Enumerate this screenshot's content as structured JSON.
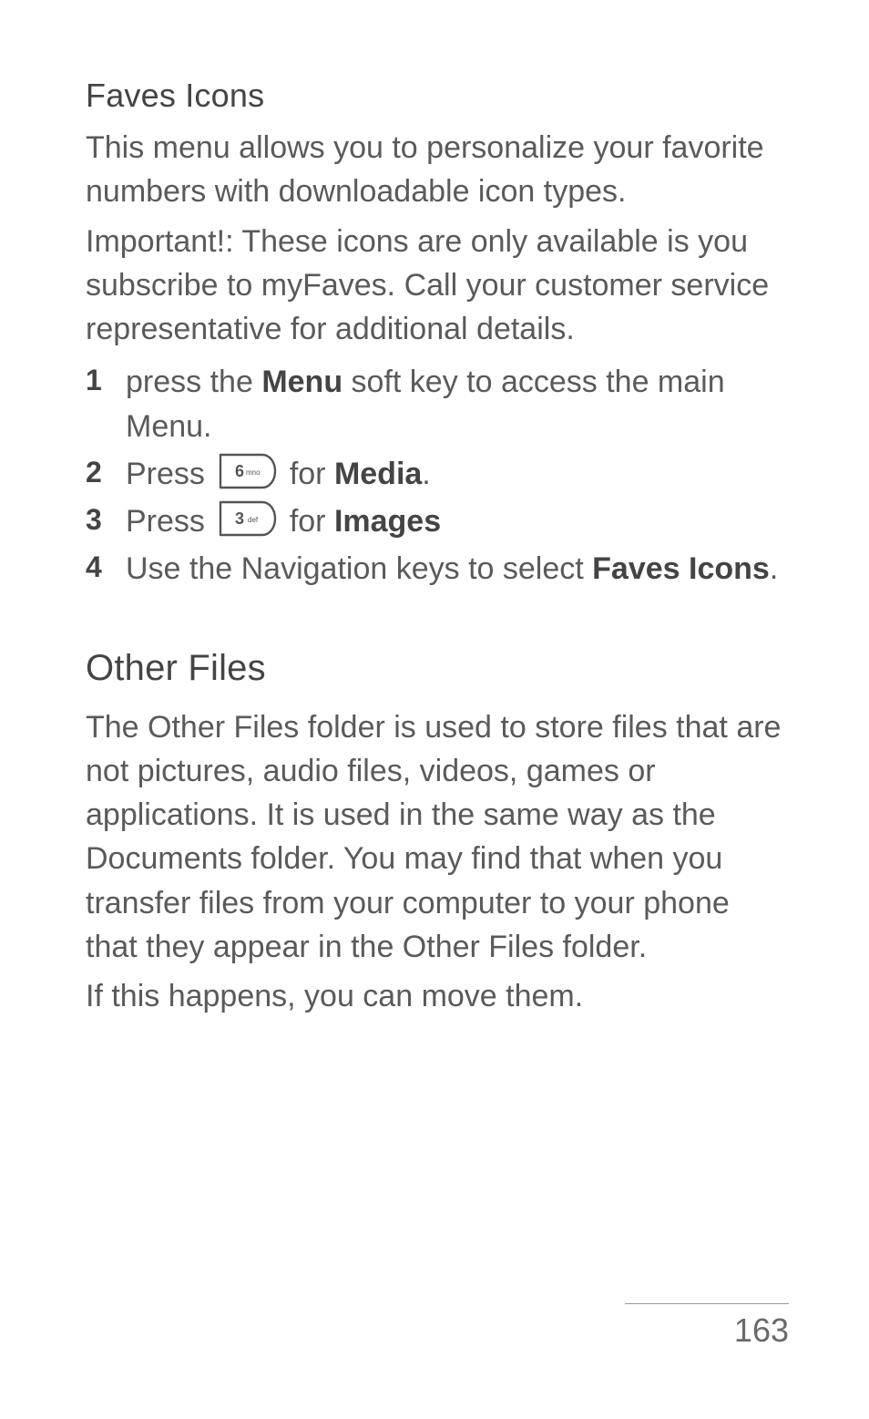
{
  "faves": {
    "heading": "Faves Icons",
    "intro": "This menu allows you to personalize your favorite numbers with downloadable icon types.",
    "important": "Important!: These icons are only available is you subscribe to myFaves. Call your customer service representative for additional details.",
    "steps": {
      "s1_a": "press the ",
      "s1_bold": "Menu",
      "s1_b": " soft key to access the main Menu.",
      "s2_a": "Press ",
      "s2_for": " for ",
      "s2_bold": "Media",
      "s2_dot": ".",
      "s3_a": "Press ",
      "s3_for": " for ",
      "s3_bold": "Images",
      "s4_a": "Use the Navigation keys to select ",
      "s4_bold": "Faves Icons",
      "s4_dot": "."
    }
  },
  "keys": {
    "six": "6 mno",
    "three": "3 def"
  },
  "other": {
    "heading": "Other Files",
    "p1": "The Other Files folder is used to store files that are not pictures, audio files, videos, games or applications. It is used in the same way as the Documents folder. You may find that when you transfer files from your computer to your phone that they appear in the Other Files folder.",
    "p2": "If this happens, you can move them."
  },
  "page_number": "163"
}
